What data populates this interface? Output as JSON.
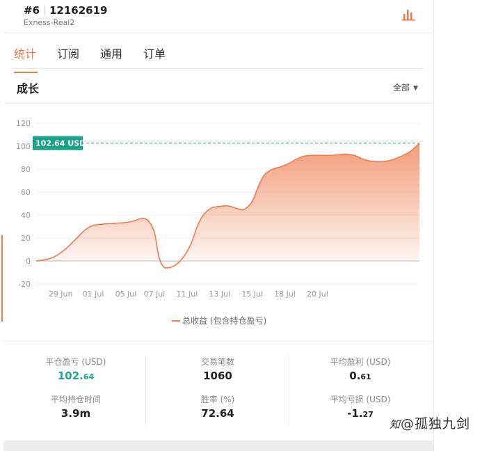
{
  "header": {
    "account_number": "#6",
    "account_id": "12162619",
    "server": "Exness-Real2",
    "chart_button_icon": "bar-chart-icon"
  },
  "tabs": [
    {
      "label": "统计",
      "active": true
    },
    {
      "label": "订阅",
      "active": false
    },
    {
      "label": "通用",
      "active": false
    },
    {
      "label": "订单",
      "active": false
    }
  ],
  "section": {
    "title": "成长",
    "range": "全部",
    "range_icon": "caret-down-icon"
  },
  "chart_data": {
    "type": "area",
    "x_tick_labels": [
      "29 Jun",
      "01 Jul",
      "05 Jul",
      "07 Jul",
      "11 Jul",
      "13 Jul",
      "15 Jul",
      "18 Jul",
      "20 Jul"
    ],
    "y_ticks": [
      120,
      100,
      80,
      60,
      40,
      20,
      0,
      -20
    ],
    "ylim": [
      -20,
      120
    ],
    "current_value_label": "102.64 USD",
    "current_value": 102.64,
    "legend": "总收益 (包含持仓盈亏)",
    "legend_position": "bottom",
    "accent_color": "#f07a4c",
    "marker_color": "#18a389",
    "points": [
      [
        0,
        0
      ],
      [
        2,
        1
      ],
      [
        4,
        3
      ],
      [
        6,
        7
      ],
      [
        8,
        13
      ],
      [
        10,
        20
      ],
      [
        12,
        27
      ],
      [
        14,
        31
      ],
      [
        16,
        32
      ],
      [
        18,
        32.5
      ],
      [
        20,
        33
      ],
      [
        22,
        33.5
      ],
      [
        24,
        35
      ],
      [
        26,
        37
      ],
      [
        27.5,
        35
      ],
      [
        29,
        25
      ],
      [
        30,
        5
      ],
      [
        31,
        -4
      ],
      [
        32,
        -6
      ],
      [
        34,
        -4
      ],
      [
        36,
        3
      ],
      [
        38,
        15
      ],
      [
        39.5,
        30
      ],
      [
        41,
        40
      ],
      [
        43,
        46
      ],
      [
        45,
        47.5
      ],
      [
        47,
        48
      ],
      [
        49,
        46
      ],
      [
        51,
        45
      ],
      [
        53,
        52
      ],
      [
        54.5,
        65
      ],
      [
        56,
        75
      ],
      [
        58,
        80
      ],
      [
        60,
        82
      ],
      [
        62,
        85
      ],
      [
        64,
        89
      ],
      [
        66,
        91.5
      ],
      [
        68,
        92
      ],
      [
        70,
        92
      ],
      [
        72,
        92
      ],
      [
        74,
        92.5
      ],
      [
        76,
        93
      ],
      [
        78,
        92
      ],
      [
        80,
        89
      ],
      [
        82,
        87
      ],
      [
        84,
        86.5
      ],
      [
        86,
        87
      ],
      [
        88,
        89
      ],
      [
        90,
        92
      ],
      [
        92,
        96
      ],
      [
        94,
        102.64
      ]
    ],
    "x_tick_positions": [
      6,
      14,
      22,
      29,
      37,
      45,
      53,
      61,
      69
    ],
    "x_range": [
      0,
      94
    ]
  },
  "stats": [
    {
      "label": "平仓盈亏 (USD)",
      "int": "102.",
      "frac": "64",
      "positive": true
    },
    {
      "label": "平均持仓时间",
      "int": "3.9m",
      "frac": "",
      "positive": false
    },
    {
      "label": "交易笔数",
      "int": "1060",
      "frac": "",
      "positive": false
    },
    {
      "label": "胜率 (%)",
      "int": "72.64",
      "frac": "",
      "positive": false
    },
    {
      "label": "平均盈利 (USD)",
      "int": "0.",
      "frac": "61",
      "positive": false
    },
    {
      "label": "平均亏损 (USD)",
      "int": "-1.",
      "frac": "27",
      "positive": false
    }
  ],
  "watermark": "@孤独九剑",
  "watermark_icon": "zhihu-logo-icon"
}
